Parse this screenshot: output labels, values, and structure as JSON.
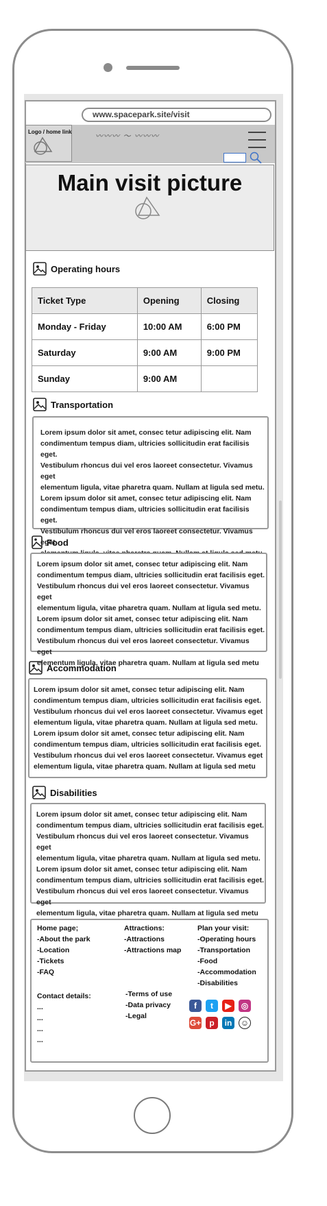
{
  "browser": {
    "url": "www.spacepark.site/visit"
  },
  "header": {
    "logo_label": "Logo / home link",
    "hero_title": "Main visit picture"
  },
  "operating_hours": {
    "title": "Operating hours",
    "columns": [
      "Ticket Type",
      "Opening",
      "Closing"
    ],
    "rows": [
      [
        "Monday - Friday",
        "10:00 AM",
        "6:00 PM"
      ],
      [
        "Saturday",
        "9:00 AM",
        "9:00 PM"
      ],
      [
        "Sunday",
        "9:00 AM",
        ""
      ]
    ]
  },
  "sections": [
    {
      "title": "Transportation",
      "lines": [
        "Lorem ipsum dolor sit amet, consec tetur adipiscing elit. Nam",
        "condimentum tempus diam, ultricies sollicitudin erat facilisis eget.",
        "Vestibulum rhoncus dui vel eros laoreet consectetur. Vivamus eget",
        "elementum ligula, vitae pharetra quam. Nullam at ligula sed metu.",
        "Lorem ipsum dolor sit amet, consec tetur adipiscing elit. Nam",
        "condimentum tempus diam, ultricies sollicitudin erat facilisis eget.",
        "Vestibulum rhoncus dui vel eros laoreet consectetur. Vivamus eget",
        "elementum ligula, vitae pharetra quam. Nullam at ligula sed metu"
      ]
    },
    {
      "title": "Food",
      "lines": [
        "Lorem ipsum dolor sit amet, consec tetur adipiscing elit. Nam",
        "condimentum tempus diam, ultricies sollicitudin erat facilisis eget.",
        "Vestibulum rhoncus dui vel eros laoreet consectetur. Vivamus eget",
        "elementum ligula, vitae pharetra quam. Nullam at ligula sed metu.",
        "Lorem ipsum dolor sit amet, consec tetur adipiscing elit. Nam",
        "condimentum tempus diam, ultricies sollicitudin erat facilisis eget.",
        "Vestibulum rhoncus dui vel eros laoreet consectetur. Vivamus eget",
        "elementum ligula, vitae pharetra quam. Nullam at ligula sed metu"
      ]
    },
    {
      "title": "Accommodation",
      "lines": [
        "Lorem ipsum dolor sit amet, consec tetur adipiscing elit. Nam",
        "condimentum tempus diam, ultricies sollicitudin erat facilisis eget.",
        "Vestibulum rhoncus dui vel eros laoreet consectetur. Vivamus eget",
        "elementum ligula, vitae pharetra quam. Nullam at ligula sed metu.",
        "Lorem ipsum dolor sit amet, consec tetur adipiscing elit. Nam",
        "condimentum tempus diam, ultricies sollicitudin erat facilisis eget.",
        "Vestibulum rhoncus dui vel eros laoreet consectetur. Vivamus eget",
        "elementum ligula, vitae pharetra quam. Nullam at ligula sed metu"
      ]
    },
    {
      "title": "Disabilities",
      "lines": [
        "Lorem ipsum dolor sit amet, consec tetur adipiscing elit. Nam",
        "condimentum tempus diam, ultricies sollicitudin erat facilisis eget.",
        "Vestibulum rhoncus dui vel eros laoreet consectetur. Vivamus eget",
        "elementum ligula, vitae pharetra quam. Nullam at ligula sed metu.",
        "Lorem ipsum dolor sit amet, consec tetur adipiscing elit. Nam",
        "condimentum tempus diam, ultricies sollicitudin erat facilisis eget.",
        "Vestibulum rhoncus dui vel eros laoreet consectetur. Vivamus eget",
        "elementum ligula, vitae pharetra quam. Nullam at ligula sed metu"
      ]
    }
  ],
  "footer": {
    "home": [
      "Home page;",
      "-About the park",
      "-Location",
      "-Tickets",
      "-FAQ"
    ],
    "attractions": [
      "Attractions:",
      "-Attractions",
      "-Attractions map"
    ],
    "plan": [
      "Plan your visit:",
      "-Operating hours",
      "-Transportation",
      "-Food",
      "-Accommodation",
      "-Disabilities"
    ],
    "contact": [
      "Contact details:",
      "...",
      "...",
      "...",
      "..."
    ],
    "legal": [
      "-Terms of use",
      "-Data privacy",
      "-Legal"
    ]
  },
  "social": {
    "icons": [
      {
        "name": "facebook-icon",
        "glyph": "f",
        "color": "#3b5998"
      },
      {
        "name": "twitter-icon",
        "glyph": "t",
        "color": "#1da1f2"
      },
      {
        "name": "youtube-icon",
        "glyph": "▶",
        "color": "#e62117"
      },
      {
        "name": "instagram-icon",
        "glyph": "◎",
        "color": "#c13584"
      },
      {
        "name": "google-plus-icon",
        "glyph": "G+",
        "color": "#dd4b39"
      },
      {
        "name": "pinterest-icon",
        "glyph": "p",
        "color": "#cb2027"
      },
      {
        "name": "linkedin-icon",
        "glyph": "in",
        "color": "#0077b5"
      },
      {
        "name": "snapchat-icon",
        "glyph": "☺",
        "color": "#ffffff"
      }
    ]
  }
}
